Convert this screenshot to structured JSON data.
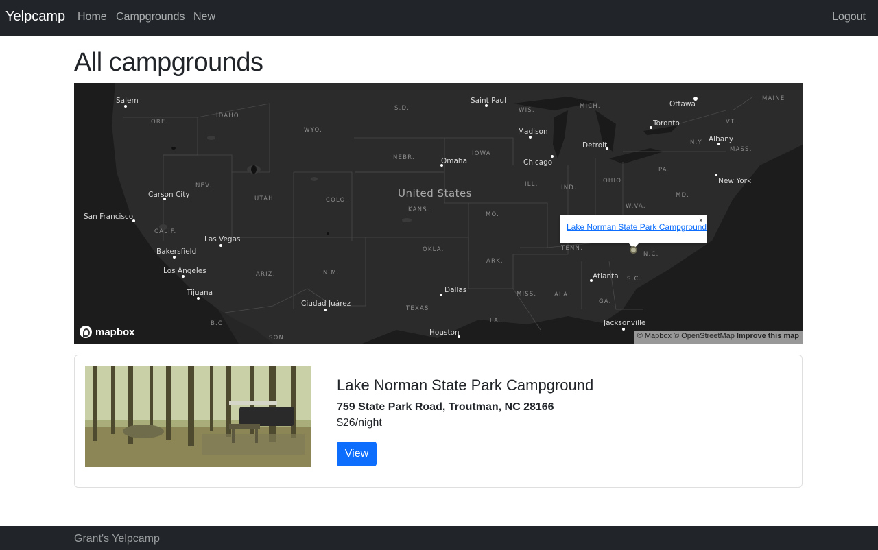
{
  "navbar": {
    "brand": "Yelpcamp",
    "links": [
      "Home",
      "Campgrounds",
      "New"
    ],
    "logout": "Logout"
  },
  "page": {
    "title": "All campgrounds"
  },
  "map": {
    "country_label": "United States",
    "states": [
      "ORE.",
      "IDAHO",
      "WYO.",
      "S.D.",
      "NEBR.",
      "IOWA",
      "WIS.",
      "MICH.",
      "NEV.",
      "UTAH",
      "COLO.",
      "KANS.",
      "MO.",
      "ILL.",
      "IND.",
      "OHIO",
      "PA.",
      "N.Y.",
      "VT.",
      "MAINE",
      "MASS.",
      "CALIF.",
      "ARIZ.",
      "N.M.",
      "OKLA.",
      "ARK.",
      "TENN.",
      "N.C.",
      "S.C.",
      "W.VA.",
      "MD.",
      "TEXAS",
      "MISS.",
      "ALA.",
      "GA.",
      "LA.",
      "B.C.",
      "SON."
    ],
    "cities": [
      "Salem",
      "Saint Paul",
      "Madison",
      "Ottawa",
      "Toronto",
      "Albany",
      "Detroit",
      "Chicago",
      "Omaha",
      "New York",
      "Carson City",
      "San Francisco",
      "Las Vegas",
      "Bakersfield",
      "Los Angeles",
      "Tijuana",
      "Ciudad Juárez",
      "Dallas",
      "Atlanta",
      "Houston",
      "Jacksonville"
    ],
    "popup_link": "Lake Norman State Park Campground",
    "popup_close": "×",
    "logo_text": "mapbox",
    "attribution_text": "© Mapbox © OpenStreetMap",
    "attribution_improve": "Improve this map",
    "colors": {
      "water": "#1a1a1a",
      "land": "#2f2f2f",
      "borders": "#4a4a4a"
    }
  },
  "campground": {
    "title": "Lake Norman State Park Campground",
    "address": "759 State Park Road, Troutman, NC 28166",
    "price": "$26/night",
    "view_label": "View",
    "image_alt": "campsite photo"
  },
  "footer": {
    "text": "Grant's Yelpcamp"
  }
}
